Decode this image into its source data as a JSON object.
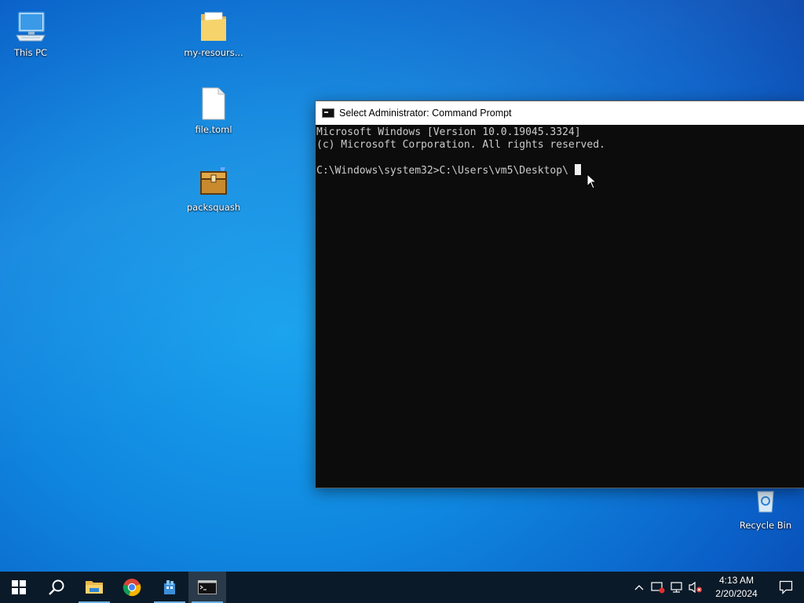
{
  "desktop": {
    "icons": [
      {
        "label": "This PC",
        "icon": "computer-icon"
      },
      {
        "label": "my-resours...",
        "icon": "folder-icon"
      },
      {
        "label": "file.toml",
        "icon": "file-icon"
      },
      {
        "label": "packsquash",
        "icon": "package-box-icon"
      },
      {
        "label": "Recycle Bin",
        "icon": "recycle-bin-icon"
      }
    ]
  },
  "window": {
    "title": "Select Administrator: Command Prompt",
    "lines": [
      "Microsoft Windows [Version 10.0.19045.3324]",
      "(c) Microsoft Corporation. All rights reserved.",
      "",
      "C:\\Windows\\system32>C:\\Users\\vm5\\Desktop\\"
    ]
  },
  "taskbar": {
    "apps": [
      {
        "icon": "windows-start-icon"
      },
      {
        "icon": "search-icon"
      },
      {
        "icon": "file-explorer-icon"
      },
      {
        "icon": "chrome-icon"
      },
      {
        "icon": "app-icon"
      },
      {
        "icon": "command-prompt-icon"
      }
    ],
    "tray": {
      "icons": [
        "chevron-up-icon",
        "security-icon",
        "network-icon",
        "volume-muted-icon"
      ],
      "time": "4:13 AM",
      "date": "2/20/2024",
      "notification_icon": "notification-icon"
    }
  },
  "colors": {
    "taskbar_bg": "#0b1a28",
    "console_bg": "#0c0c0c",
    "console_fg": "#cccccc"
  }
}
